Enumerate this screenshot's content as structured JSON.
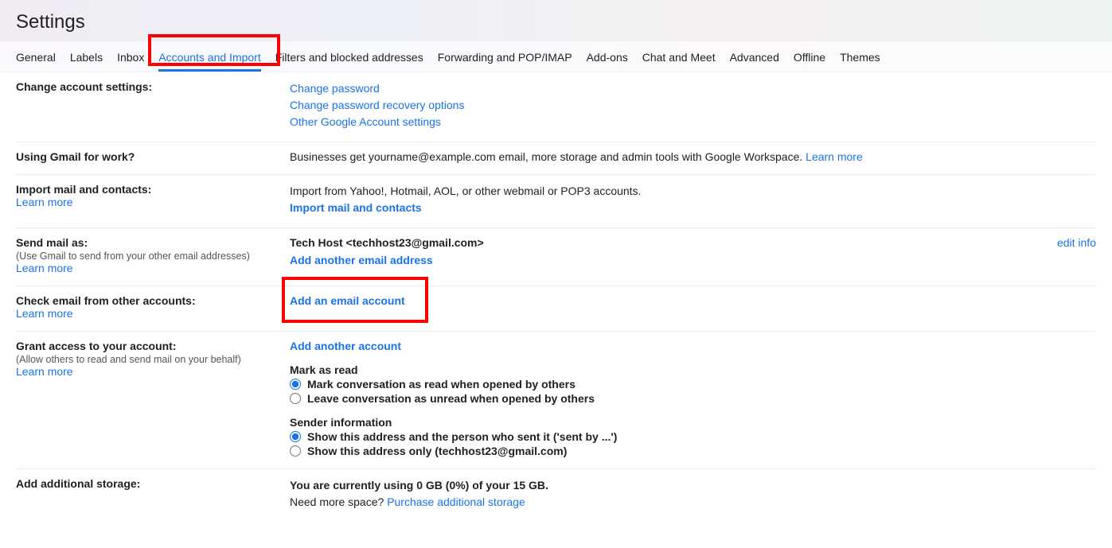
{
  "header": {
    "title": "Settings"
  },
  "tabs": [
    {
      "label": "General"
    },
    {
      "label": "Labels"
    },
    {
      "label": "Inbox"
    },
    {
      "label": "Accounts and Import",
      "active": true
    },
    {
      "label": "Filters and blocked addresses"
    },
    {
      "label": "Forwarding and POP/IMAP"
    },
    {
      "label": "Add-ons"
    },
    {
      "label": "Chat and Meet"
    },
    {
      "label": "Advanced"
    },
    {
      "label": "Offline"
    },
    {
      "label": "Themes"
    }
  ],
  "change_account": {
    "title": "Change account settings:",
    "links": {
      "password": "Change password",
      "recovery": "Change password recovery options",
      "other": "Other Google Account settings"
    }
  },
  "work": {
    "title": "Using Gmail for work?",
    "text": "Businesses get yourname@example.com email, more storage and admin tools with Google Workspace. ",
    "learn": "Learn more"
  },
  "import": {
    "title": "Import mail and contacts:",
    "learn": "Learn more",
    "desc": "Import from Yahoo!, Hotmail, AOL, or other webmail or POP3 accounts.",
    "action": "Import mail and contacts"
  },
  "send_as": {
    "title": "Send mail as:",
    "sub": "(Use Gmail to send from your other email addresses)",
    "learn": "Learn more",
    "identity": "Tech Host <techhost23@gmail.com>",
    "add": "Add another email address",
    "edit": "edit info"
  },
  "check_other": {
    "title": "Check email from other accounts:",
    "learn": "Learn more",
    "add": "Add an email account"
  },
  "grant": {
    "title": "Grant access to your account:",
    "sub": "(Allow others to read and send mail on your behalf)",
    "learn": "Learn more",
    "add": "Add another account",
    "mark_header": "Mark as read",
    "mark_read": "Mark conversation as read when opened by others",
    "mark_unread": "Leave conversation as unread when opened by others",
    "sender_header": "Sender information",
    "sender_show_both": "Show this address and the person who sent it ('sent by ...')",
    "sender_show_only": "Show this address only (techhost23@gmail.com)"
  },
  "storage": {
    "title": "Add additional storage:",
    "usage": "You are currently using 0 GB (0%) of your 15 GB.",
    "need": "Need more space? ",
    "purchase": "Purchase additional storage"
  }
}
